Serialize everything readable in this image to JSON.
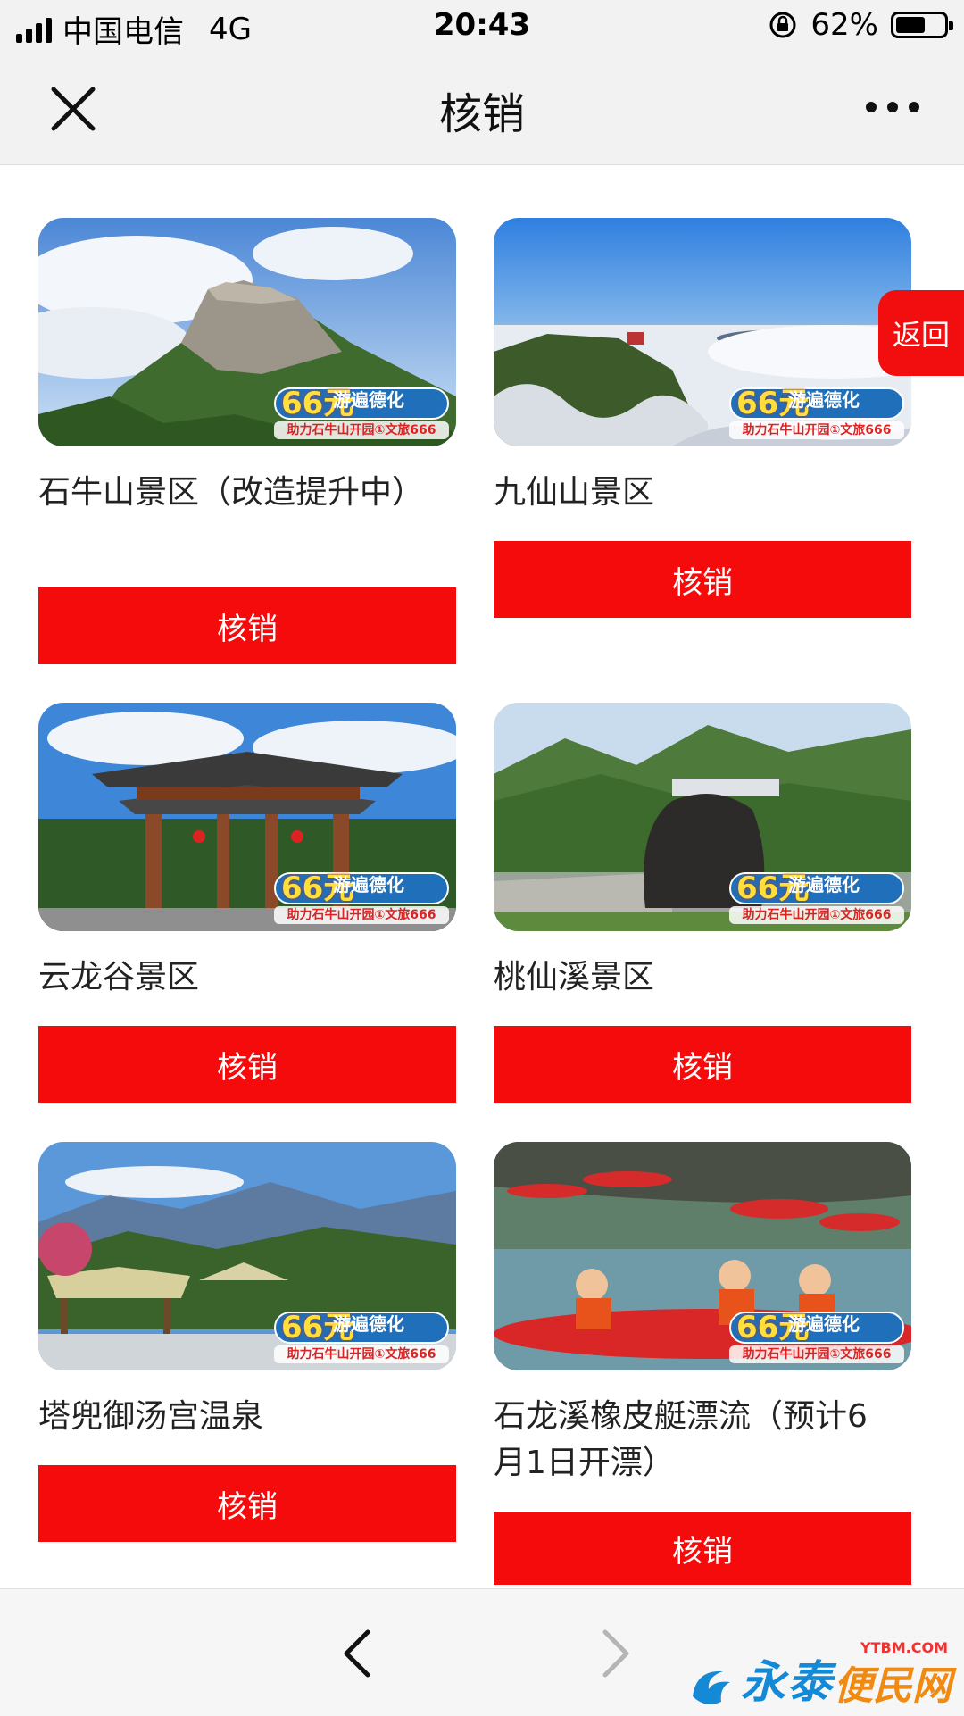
{
  "status_bar": {
    "carrier": "中国电信",
    "network": "4G",
    "time": "20:43",
    "battery": "62%",
    "battery_level": 0.62
  },
  "nav": {
    "title": "核销",
    "close_icon": "close-icon",
    "more_icon": "more-icon"
  },
  "float_back": {
    "label": "返回"
  },
  "badge": {
    "amount": "66元",
    "slogan": "游遍德化",
    "subline": "助力石牛山开园①文旅666"
  },
  "cards": [
    {
      "title": "石牛山景区（改造提升中）",
      "button": "核销",
      "image": "mountain-rock-photo"
    },
    {
      "title": "九仙山景区",
      "button": "核销",
      "image": "sea-of-clouds-photo"
    },
    {
      "title": "云龙谷景区",
      "button": "核销",
      "image": "temple-gate-photo"
    },
    {
      "title": "桃仙溪景区",
      "button": "核销",
      "image": "engraved-stone-photo"
    },
    {
      "title": "塔兜御汤宫温泉",
      "button": "核销",
      "image": "hot-spring-photo"
    },
    {
      "title": "石龙溪橡皮艇漂流（预计6月1日开漂）",
      "button": "核销",
      "image": "rafting-photo"
    }
  ],
  "bottom_bar": {
    "prev_icon": "chevron-left-icon",
    "next_icon": "chevron-right-icon",
    "watermark_main": "永泰",
    "watermark_side": "便民网",
    "watermark_url": "YTBM.COM"
  },
  "colors": {
    "accent_red": "#f50b0b",
    "bar_gray": "#f2f2f2",
    "badge_blue": "#1f6fba"
  }
}
